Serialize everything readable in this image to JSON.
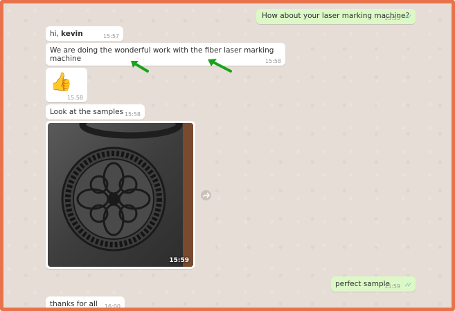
{
  "messages": [
    {
      "dir": "out",
      "text": "How about your laser marking machine?",
      "time": "15:55",
      "ticks": "✓✓"
    },
    {
      "dir": "in",
      "text": "hi,",
      "bold": "kevin",
      "time": "15:57"
    },
    {
      "dir": "in",
      "text": "We are doing the wonderful work with the fiber laser marking machine",
      "time": "15:58"
    },
    {
      "dir": "in",
      "emoji": "👍",
      "time": "15:58"
    },
    {
      "dir": "in",
      "text": "Look at the samples",
      "time": "15:58"
    },
    {
      "dir": "in",
      "image": "laser-marked-medallion",
      "time": "15:59"
    },
    {
      "dir": "out",
      "text": "perfect sample",
      "time": "15:59",
      "ticks": "✓✓"
    },
    {
      "dir": "in",
      "text": "thanks for all",
      "time": "16:00"
    }
  ],
  "colors": {
    "frame": "#e8734b",
    "outgoing": "#dcf8c6",
    "incoming": "#ffffff",
    "ticks": "#4fc3f7",
    "annotation_arrow": "#1aa31a"
  },
  "annotation": {
    "arrows": 2,
    "icon": "green-arrow-icon"
  }
}
